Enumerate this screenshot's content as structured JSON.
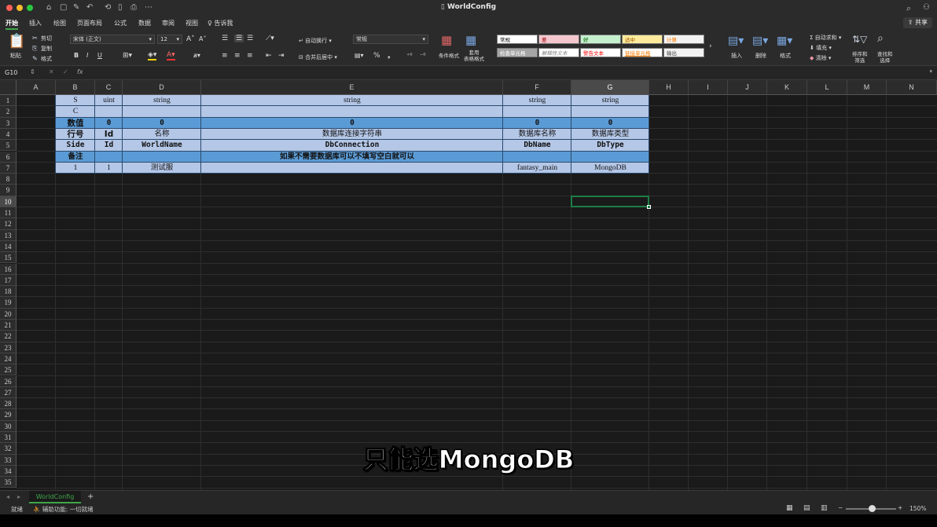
{
  "window": {
    "title": "WorldConfig"
  },
  "titlebar_icons": [
    "⌂",
    "▢",
    "✎",
    "↶",
    "⟲",
    "▯",
    "⎙",
    "⋯"
  ],
  "tabs": [
    "开始",
    "插入",
    "绘图",
    "页面布局",
    "公式",
    "数据",
    "审阅",
    "视图",
    "告诉我"
  ],
  "share": "共享",
  "ribbon": {
    "paste": "粘贴",
    "cut": "剪切",
    "copy": "复制",
    "format_painter": "格式",
    "font_name": "宋体 (正文)",
    "font_size": "12",
    "bold": "B",
    "italic": "I",
    "underline": "U",
    "wrap_text": "自动换行",
    "merge_center": "合并后居中",
    "number_format": "常规",
    "percent": "%",
    "comma": "❟",
    "conditional_format": "条件格式",
    "table_format": "套用\n表格格式",
    "styles": [
      {
        "label": "常规",
        "bg": "#ffffff",
        "color": "#000000"
      },
      {
        "label": "差",
        "bg": "#f4c7ce",
        "color": "#9c0006"
      },
      {
        "label": "好",
        "bg": "#c6efce",
        "color": "#006100"
      },
      {
        "label": "适中",
        "bg": "#ffeb9c",
        "color": "#9c5700"
      },
      {
        "label": "计算",
        "bg": "#f2f2f2",
        "color": "#fa7d00"
      },
      {
        "label": "检查单元格",
        "bg": "#a5a5a5",
        "color": "#ffffff"
      },
      {
        "label": "解释性文本",
        "bg": "#ffffff",
        "color": "#7f7f7f"
      },
      {
        "label": "警告文本",
        "bg": "#ffffff",
        "color": "#ff0000"
      },
      {
        "label": "链接单元格",
        "bg": "#ffffff",
        "color": "#fa7d00"
      },
      {
        "label": "输出",
        "bg": "#f2f2f2",
        "color": "#3f3f3f"
      }
    ],
    "insert": "插入",
    "delete": "删除",
    "format": "格式",
    "autosum": "自动求和",
    "fill": "填充",
    "clear": "清除",
    "sort_filter": "排序和\n筛选",
    "find_select": "查找和\n选择"
  },
  "formula_bar": {
    "name_box": "G10",
    "fx": "fx",
    "value": ""
  },
  "columns": [
    {
      "name": "A"
    },
    {
      "name": "B"
    },
    {
      "name": "C"
    },
    {
      "name": "D"
    },
    {
      "name": "E"
    },
    {
      "name": "F"
    },
    {
      "name": "G",
      "selected": true
    },
    {
      "name": "H"
    },
    {
      "name": "I"
    },
    {
      "name": "J"
    },
    {
      "name": "K"
    },
    {
      "name": "L"
    },
    {
      "name": "M"
    },
    {
      "name": "N"
    }
  ],
  "row_count": 35,
  "selected_row": 10,
  "cells": [
    {
      "id": "B1",
      "v": "S"
    },
    {
      "id": "C1",
      "v": "uint"
    },
    {
      "id": "D1",
      "v": "string"
    },
    {
      "id": "E1",
      "v": "string"
    },
    {
      "id": "F1",
      "v": "string"
    },
    {
      "id": "G1",
      "v": "string"
    },
    {
      "id": "B2",
      "v": "C"
    },
    {
      "id": "B3",
      "v": "数值"
    },
    {
      "id": "C3",
      "v": "0"
    },
    {
      "id": "D3",
      "v": "0"
    },
    {
      "id": "E3",
      "v": "0"
    },
    {
      "id": "F3",
      "v": "0"
    },
    {
      "id": "G3",
      "v": "0"
    },
    {
      "id": "B4",
      "v": "行号"
    },
    {
      "id": "C4",
      "v": "Id"
    },
    {
      "id": "D4",
      "v": "名称"
    },
    {
      "id": "E4",
      "v": "数据库连接字符串"
    },
    {
      "id": "F4",
      "v": "数据库名称"
    },
    {
      "id": "G4",
      "v": "数据库类型"
    },
    {
      "id": "B5",
      "v": "Side"
    },
    {
      "id": "C5",
      "v": "Id"
    },
    {
      "id": "D5",
      "v": "WorldName"
    },
    {
      "id": "E5",
      "v": "DbConnection"
    },
    {
      "id": "F5",
      "v": "DbName"
    },
    {
      "id": "G5",
      "v": "DbType"
    },
    {
      "id": "B6",
      "v": "备注"
    },
    {
      "id": "D6",
      "v": "如果不需要数据库可以不填写空白就可以"
    },
    {
      "id": "B7",
      "v": "1"
    },
    {
      "id": "C7",
      "v": "1"
    },
    {
      "id": "D7",
      "v": "测试服"
    },
    {
      "id": "F7",
      "v": "fantasy_main"
    },
    {
      "id": "G7",
      "v": "MongoDB"
    }
  ],
  "fill_colors": {
    "light_blue": "#b4c7e7",
    "mid_blue": "#5b9bd5",
    "selection": "#1e7d45"
  },
  "sheet_tab": "WorldConfig",
  "add_sheet": "+",
  "status": {
    "ready": "就绪",
    "accessibility": "辅助功能: 一切就绪",
    "zoom": "150%"
  },
  "subtitle": "只能选MongoDB"
}
